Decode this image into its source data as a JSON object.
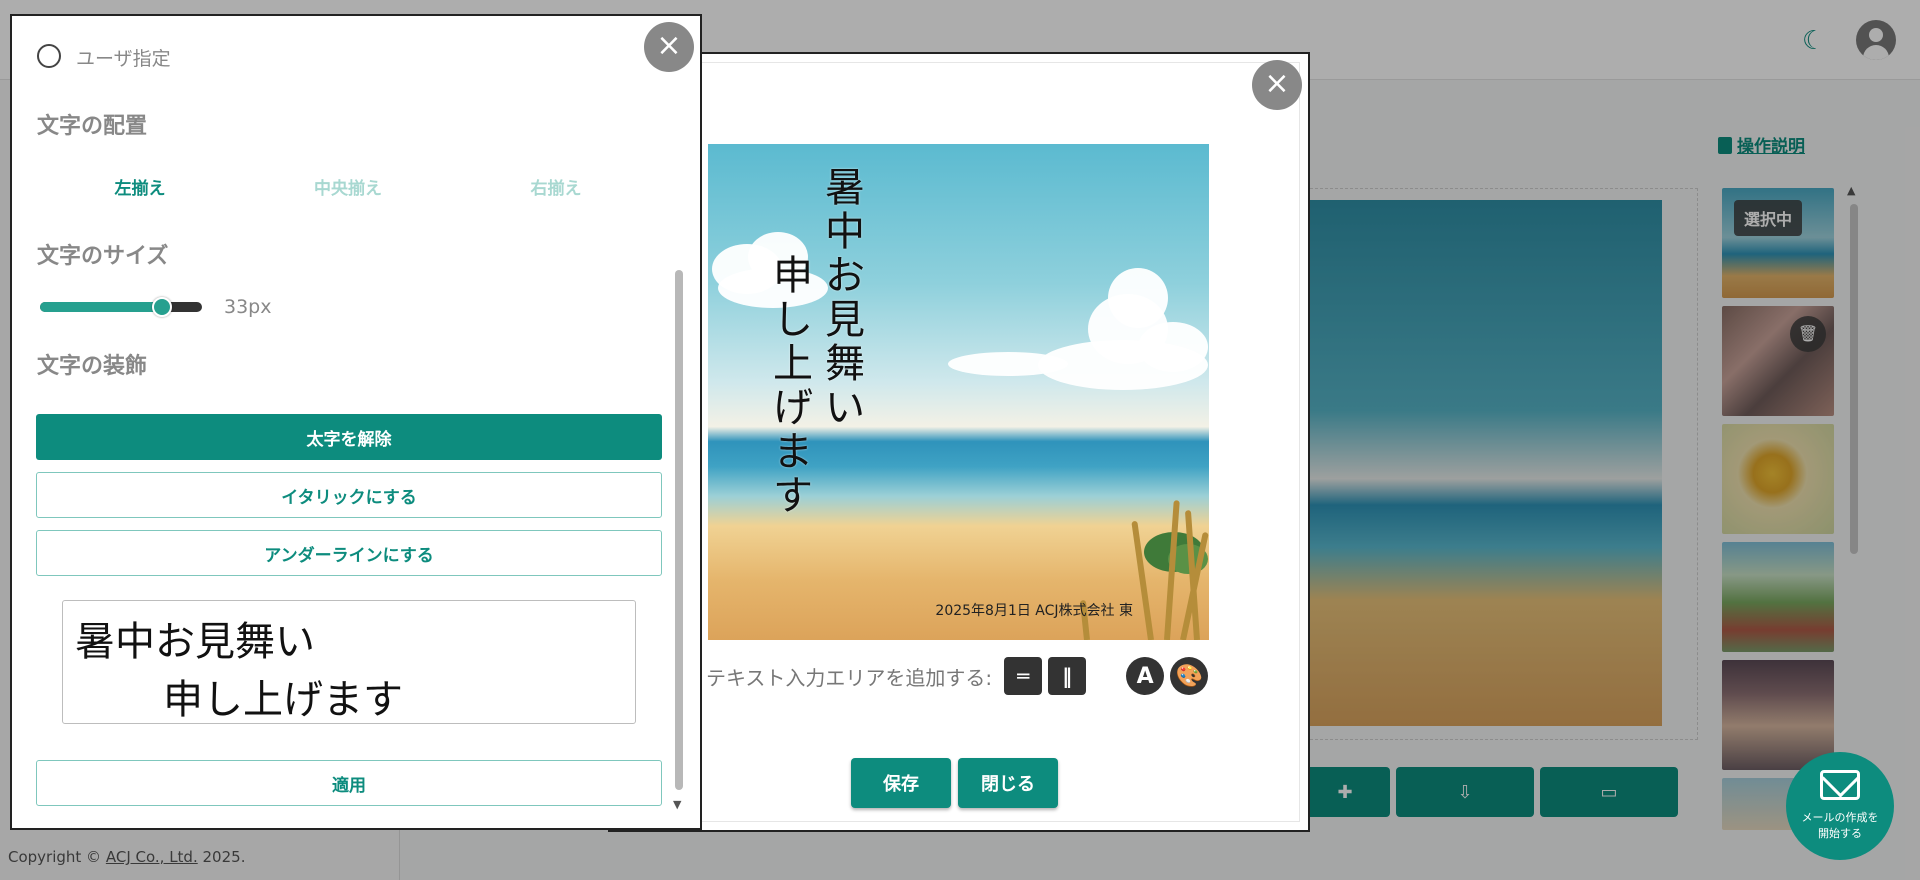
{
  "header": {
    "theme_icon": "moon-icon",
    "avatar_icon": "user-avatar-icon"
  },
  "background": {
    "manual_link": "操作説明",
    "selected_badge": "選択中",
    "copyright_prefix": "Copyright ©",
    "copyright_company": "ACJ Co., Ltd.",
    "copyright_year": "2025.",
    "mail_button": [
      "メールの作成を",
      "開始する"
    ]
  },
  "editor": {
    "card": {
      "text_columns": [
        "暑中お見舞い",
        "申し上げます"
      ],
      "footer": "2025年8月1日  ACJ株式会社  東"
    },
    "add_text_label": "テキスト入力エリアを追加する:",
    "horizontal_btn": "═",
    "vertical_btn": "‖",
    "font_btn": "A",
    "palette_btn": "🎨",
    "save_label": "保存",
    "close_label": "閉じる",
    "close_icon": "×"
  },
  "settings": {
    "close_icon": "×",
    "custom_radio_label": "ユーザ指定",
    "alignment": {
      "heading": "文字の配置",
      "options": [
        "左揃え",
        "中央揃え",
        "右揃え"
      ],
      "selected": "左揃え"
    },
    "size": {
      "heading": "文字のサイズ",
      "value_label": "33px",
      "slider_level": 0.75
    },
    "decoration": {
      "heading": "文字の装飾",
      "bold_btn": "太字を解除",
      "italic_btn": "イタリックにする",
      "underline_btn": "アンダーラインにする"
    },
    "preview_lines": [
      "暑中お見舞い",
      "申し上げます"
    ],
    "apply_btn": "適用"
  },
  "colors": {
    "accent": "#0d8c7e",
    "accent_light": "#7fc7bd"
  }
}
